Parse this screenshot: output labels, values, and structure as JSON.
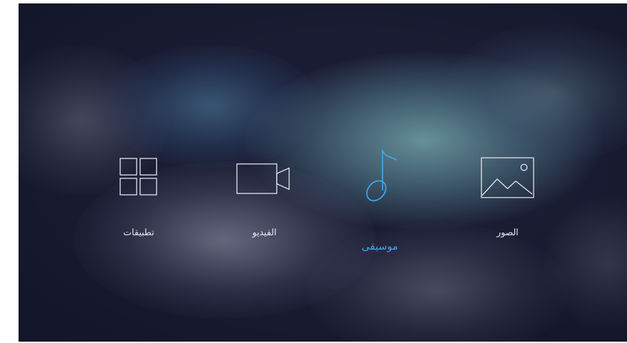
{
  "menu": {
    "items": [
      {
        "id": "apps",
        "label": "تطبيقات",
        "icon": "grid-icon",
        "selected": false
      },
      {
        "id": "video",
        "label": "الفيديو",
        "icon": "video-camera-icon",
        "selected": false
      },
      {
        "id": "music",
        "label": "موسيقى",
        "icon": "music-note-icon",
        "selected": true
      },
      {
        "id": "photos",
        "label": "الصور",
        "icon": "picture-icon",
        "selected": false
      }
    ]
  },
  "colors": {
    "background": "#1a1c33",
    "icon_default": "#e8eaf0",
    "accent": "#3fa6e8"
  }
}
